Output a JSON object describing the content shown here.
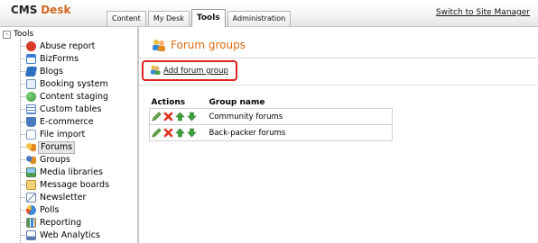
{
  "header": {
    "logo_cms": "CMS",
    "logo_desk": "Desk",
    "tabs": [
      {
        "label": "Content"
      },
      {
        "label": "My Desk"
      },
      {
        "label": "Tools"
      },
      {
        "label": "Administration"
      }
    ],
    "active_tab": "Tools",
    "switch_link": "Switch to Site Manager"
  },
  "tree": {
    "root_expander": "-",
    "root_label": "Tools",
    "items": [
      {
        "label": "Abuse report",
        "icon": "abuse-report-icon",
        "color": "#d83a2a"
      },
      {
        "label": "BizForms",
        "icon": "bizforms-icon",
        "color": "#3a7bd5"
      },
      {
        "label": "Blogs",
        "icon": "blogs-icon",
        "color": "#2f6fc2"
      },
      {
        "label": "Booking system",
        "icon": "booking-system-icon",
        "color": "#6a8fb8"
      },
      {
        "label": "Content staging",
        "icon": "content-staging-icon",
        "color": "#3c9a3c"
      },
      {
        "label": "Custom tables",
        "icon": "custom-tables-icon",
        "color": "#5b86c9"
      },
      {
        "label": "E-commerce",
        "icon": "e-commerce-icon",
        "color": "#4a7ac0"
      },
      {
        "label": "File import",
        "icon": "file-import-icon",
        "color": "#7a9ac8"
      },
      {
        "label": "Forums",
        "icon": "forums-icon",
        "color": "#e6a020"
      },
      {
        "label": "Groups",
        "icon": "groups-icon",
        "color": "#e08a20"
      },
      {
        "label": "Media libraries",
        "icon": "media-libraries-icon",
        "color": "#4aa04a"
      },
      {
        "label": "Message boards",
        "icon": "message-boards-icon",
        "color": "#e0b040"
      },
      {
        "label": "Newsletter",
        "icon": "newsletter-icon",
        "color": "#6a8ab0"
      },
      {
        "label": "Polls",
        "icon": "polls-icon",
        "color": "#3a8ad8"
      },
      {
        "label": "Reporting",
        "icon": "reporting-icon",
        "color": "#4a9a4a"
      },
      {
        "label": "Web Analytics",
        "icon": "web-analytics-icon",
        "color": "#5a7ab0"
      }
    ],
    "selected": "Forums"
  },
  "main": {
    "title": "Forum groups",
    "title_icon": "forum-groups-icon",
    "add_link": "Add forum group",
    "highlight_color": "#e02020",
    "grid": {
      "headers": [
        "Actions",
        "Group name"
      ],
      "rows": [
        {
          "name": "Community forums"
        },
        {
          "name": "Back-packer forums"
        }
      ],
      "action_icons": [
        "edit-icon",
        "delete-icon",
        "move-up-icon",
        "move-down-icon"
      ]
    }
  }
}
